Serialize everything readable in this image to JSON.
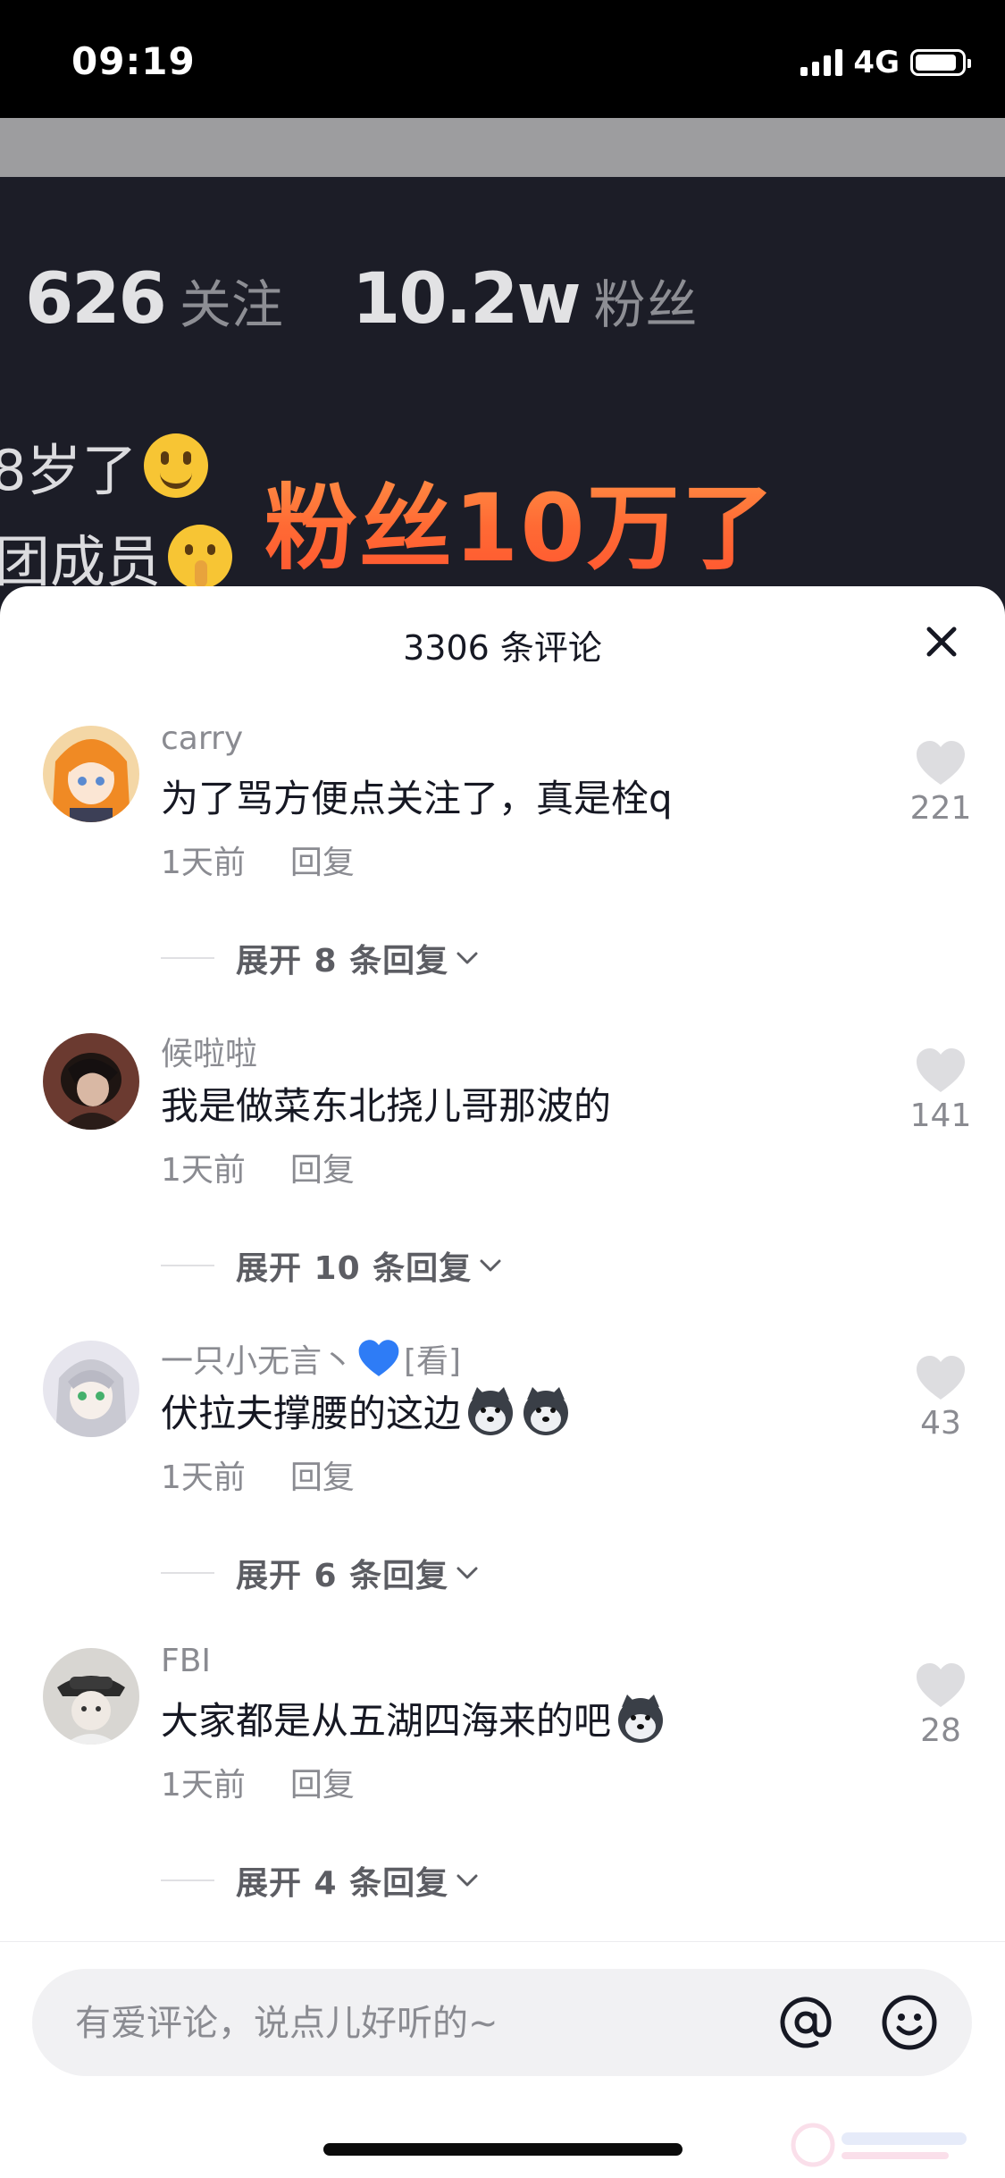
{
  "status_bar": {
    "time": "09:19",
    "network": "4G",
    "battery_level": 0.9
  },
  "profile": {
    "following_count": "626",
    "following_label": "关注",
    "followers_count": "10.2w",
    "followers_label": "粉丝",
    "bio_line_1": "8岁了",
    "bio_line_2": "团成员",
    "caption": "粉丝10万了"
  },
  "comments_panel": {
    "title": "3306 条评论",
    "comments": [
      {
        "user": "carry",
        "text": "为了骂方便点关注了，真是栓q",
        "time": "1天前",
        "reply": "回复",
        "likes": "221",
        "expand": "展开 8 条回复"
      },
      {
        "user": "候啦啦",
        "text": "我是做菜东北挠儿哥那波的",
        "time": "1天前",
        "reply": "回复",
        "likes": "141",
        "expand": "展开 10 条回复"
      },
      {
        "user_prefix": "一只小无言丶",
        "user_suffix": "[看]",
        "text": "伏拉夫撑腰的这边",
        "time": "1天前",
        "reply": "回复",
        "likes": "43",
        "expand": "展开 6 条回复"
      },
      {
        "user": "FBI",
        "text": "大家都是从五湖四海来的吧",
        "time": "1天前",
        "reply": "回复",
        "likes": "28",
        "expand": "展开 4 条回复"
      }
    ]
  },
  "input": {
    "placeholder": "有爱评论，说点儿好听的~"
  },
  "colors": {
    "accent_orange": "#ff6a34",
    "text_primary": "#161823",
    "text_secondary": "#8a8b91",
    "heart_emoji": "#2e7cf6"
  },
  "icons": [
    "close-icon",
    "like-heart-icon",
    "chevron-down-icon",
    "at-icon",
    "emoji-face-icon",
    "husky-emoji-icon",
    "blue-heart-emoji-icon"
  ]
}
